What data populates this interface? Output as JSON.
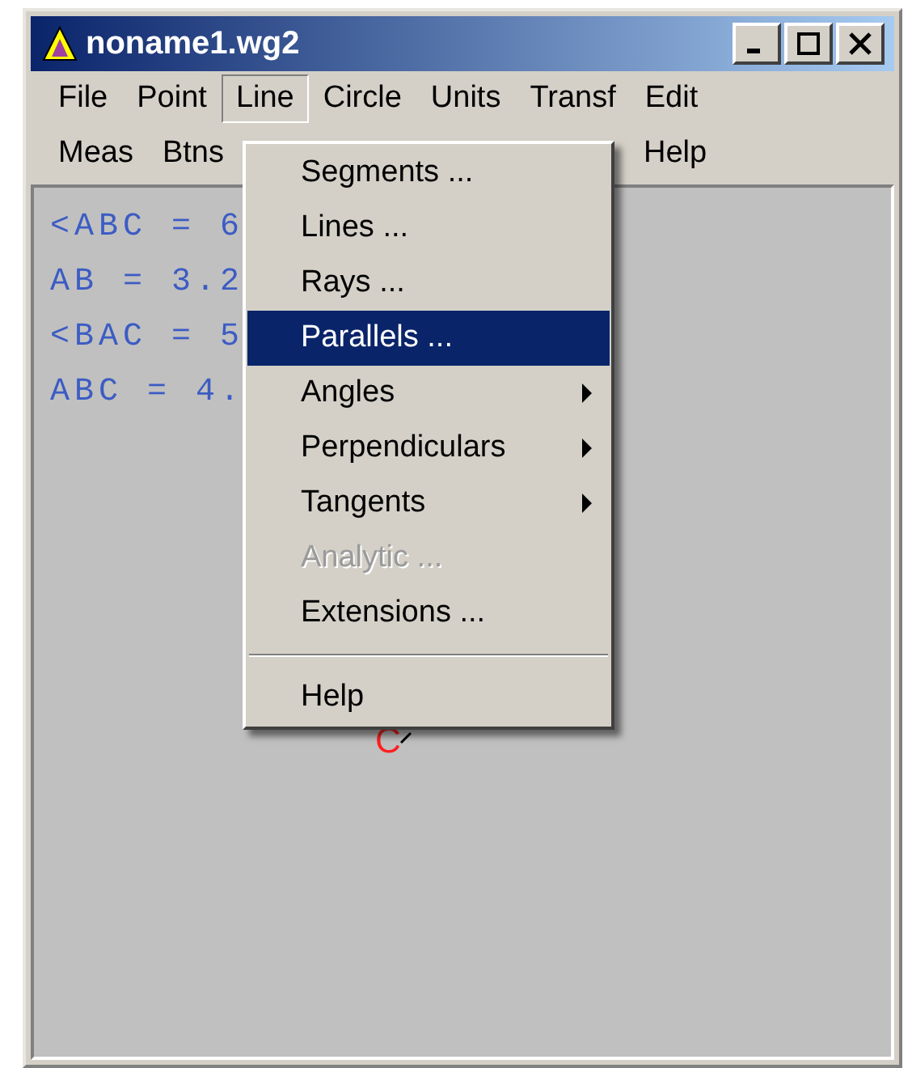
{
  "window": {
    "title": "noname1.wg2"
  },
  "menubar": [
    [
      {
        "label": "File",
        "selected": false
      },
      {
        "label": "Point",
        "selected": false
      },
      {
        "label": "Line",
        "selected": true
      },
      {
        "label": "Circle",
        "selected": false
      },
      {
        "label": "Units",
        "selected": false
      },
      {
        "label": "Transf",
        "selected": false
      },
      {
        "label": "Edit",
        "selected": false
      }
    ],
    [
      {
        "label": "Meas",
        "selected": false
      },
      {
        "label": "Btns",
        "selected": false
      },
      {
        "label": "Help",
        "selected": false
      }
    ]
  ],
  "canvas": {
    "measurements": [
      "<ABC = 6",
      "AB = 3.2",
      "<BAC = 5",
      "ABC = 4."
    ],
    "point_label": "C"
  },
  "menu": [
    {
      "kind": "item",
      "label": "Segments ...",
      "selected": false,
      "disabled": false,
      "submenu": false
    },
    {
      "kind": "item",
      "label": "Lines ...",
      "selected": false,
      "disabled": false,
      "submenu": false
    },
    {
      "kind": "item",
      "label": "Rays ...",
      "selected": false,
      "disabled": false,
      "submenu": false
    },
    {
      "kind": "item",
      "label": "Parallels ...",
      "selected": true,
      "disabled": false,
      "submenu": false
    },
    {
      "kind": "item",
      "label": "Angles",
      "selected": false,
      "disabled": false,
      "submenu": true
    },
    {
      "kind": "item",
      "label": "Perpendiculars",
      "selected": false,
      "disabled": false,
      "submenu": true
    },
    {
      "kind": "item",
      "label": "Tangents",
      "selected": false,
      "disabled": false,
      "submenu": true
    },
    {
      "kind": "item",
      "label": "Analytic ...",
      "selected": false,
      "disabled": true,
      "submenu": false
    },
    {
      "kind": "item",
      "label": "Extensions ...",
      "selected": false,
      "disabled": false,
      "submenu": false
    },
    {
      "kind": "separator"
    },
    {
      "kind": "item",
      "label": "Help",
      "selected": false,
      "disabled": false,
      "submenu": false
    }
  ]
}
